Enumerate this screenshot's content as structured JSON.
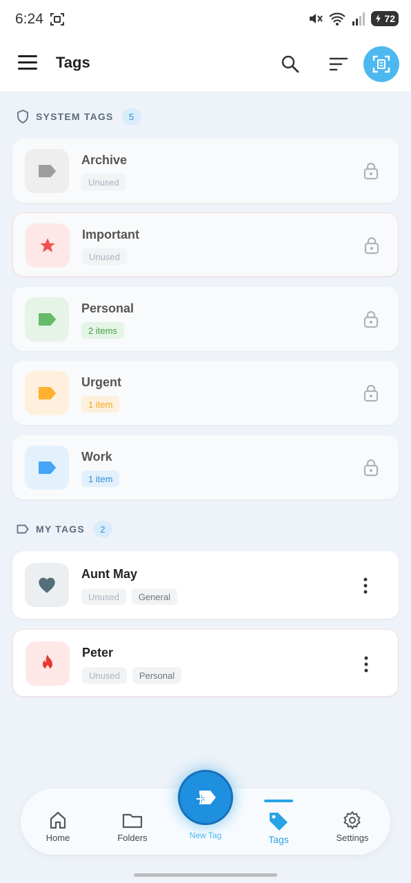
{
  "status": {
    "time": "6:24",
    "battery": "72"
  },
  "app_bar": {
    "title": "Tags"
  },
  "system_section": {
    "label": "SYSTEM TAGS",
    "count": "5"
  },
  "system_tags": [
    {
      "name": "Archive",
      "usage": "Unused",
      "color": "#9e9e9e",
      "bg": "#eeeeee"
    },
    {
      "name": "Important",
      "usage": "Unused",
      "color": "#ef5350",
      "bg": "#fde7e7"
    },
    {
      "name": "Personal",
      "usage": "2 items",
      "color": "#66bb6a",
      "bg": "#e6f4e7"
    },
    {
      "name": "Urgent",
      "usage": "1 item",
      "color": "#ffb02e",
      "bg": "#fef0dd"
    },
    {
      "name": "Work",
      "usage": "1 item",
      "color": "#42a5f5",
      "bg": "#e3f1fd"
    }
  ],
  "my_section": {
    "label": "MY TAGS",
    "count": "2"
  },
  "my_tags": [
    {
      "name": "Aunt May",
      "usage": "Unused",
      "category": "General",
      "color": "#546e7a",
      "bg": "#eceff1"
    },
    {
      "name": "Peter",
      "usage": "Unused",
      "category": "Personal",
      "color": "#e53935",
      "bg": "#fde7e7"
    }
  ],
  "nav": {
    "home": "Home",
    "folders": "Folders",
    "new_tag": "New Tag",
    "tags": "Tags",
    "settings": "Settings"
  },
  "accent": "#29a3e6"
}
